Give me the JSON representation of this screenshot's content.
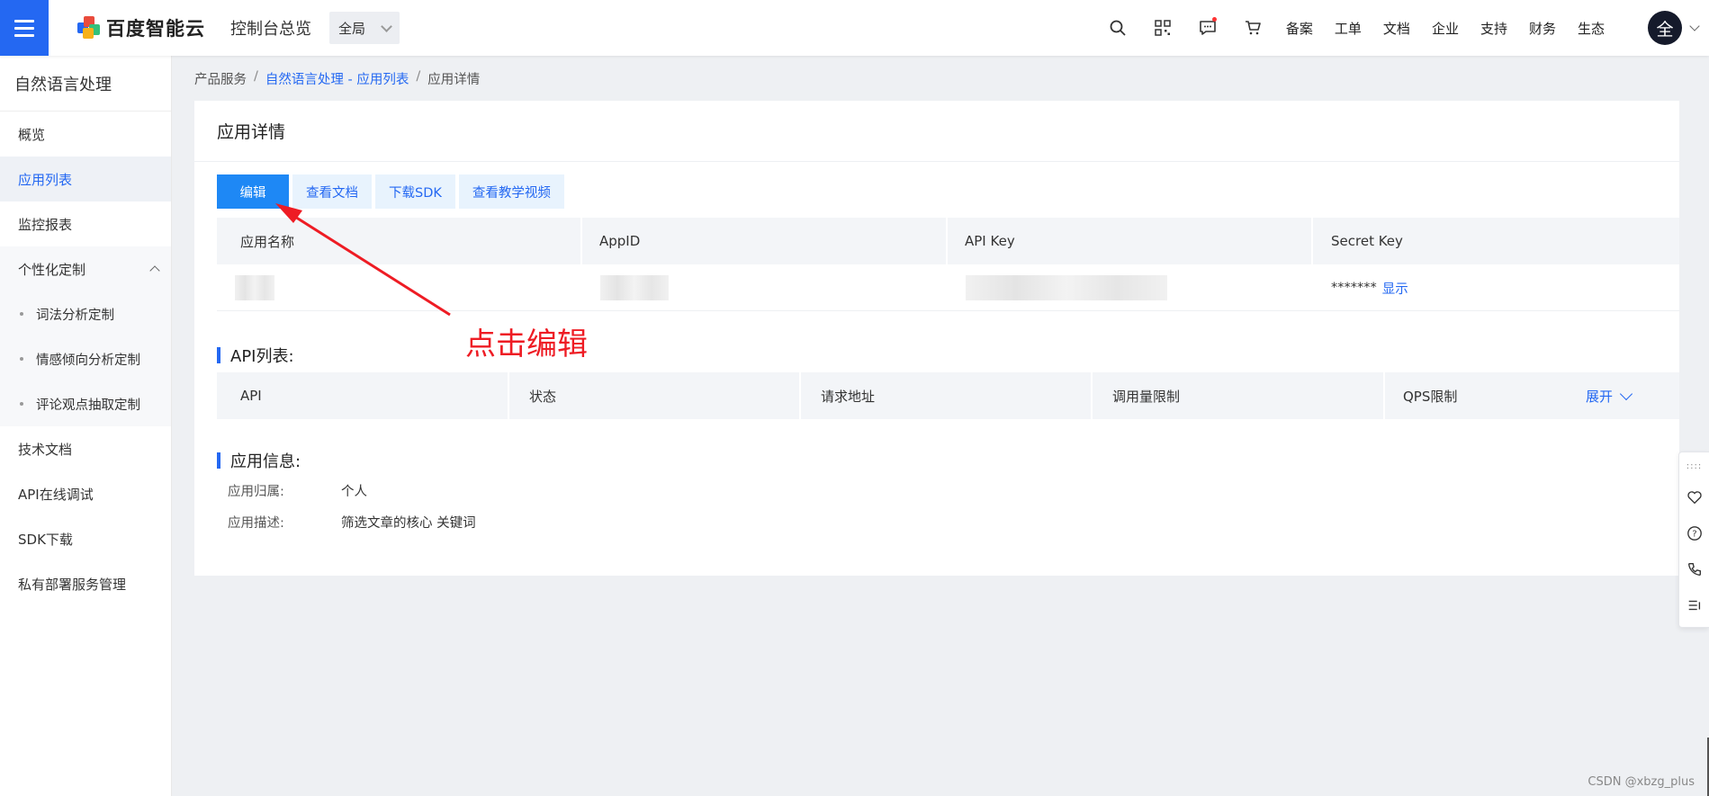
{
  "topbar": {
    "brand": "百度智能云",
    "console_title": "控制台总览",
    "region_value": "全局",
    "nav_links": [
      "备案",
      "工单",
      "文档",
      "企业",
      "支持",
      "财务",
      "生态"
    ],
    "avatar_text": "全",
    "icons": [
      "search-icon",
      "qr-code-icon",
      "message-icon",
      "cart-icon"
    ]
  },
  "sidebar": {
    "title": "自然语言处理",
    "items": [
      {
        "label": "概览"
      },
      {
        "label": "应用列表",
        "active": true
      },
      {
        "label": "监控报表"
      },
      {
        "label": "个性化定制"
      },
      {
        "label": "词法分析定制"
      },
      {
        "label": "情感倾向分析定制"
      },
      {
        "label": "评论观点抽取定制"
      },
      {
        "label": "技术文档"
      },
      {
        "label": "API在线调试"
      },
      {
        "label": "SDK下载"
      },
      {
        "label": "私有部署服务管理"
      }
    ]
  },
  "breadcrumb": {
    "root": "产品服务",
    "link": "自然语言处理 - 应用列表",
    "current": "应用详情",
    "sep": "/"
  },
  "detail": {
    "title": "应用详情",
    "buttons": {
      "edit": "编辑",
      "docs": "查看文档",
      "sdk": "下载SDK",
      "video": "查看教学视频"
    },
    "app_table": {
      "headers": [
        "应用名称",
        "AppID",
        "API Key",
        "Secret Key"
      ],
      "secret_masked": "*******",
      "show_label": "显示"
    },
    "api_section": {
      "title": "API列表:",
      "headers": [
        "API",
        "状态",
        "请求地址",
        "调用量限制",
        "QPS限制"
      ],
      "expand_label": "展开"
    },
    "info_section": {
      "title": "应用信息:",
      "owner_label": "应用归属:",
      "owner_value": "个人",
      "desc_label": "应用描述:",
      "desc_value": "筛选文章的核心 关键词"
    }
  },
  "annotation": {
    "text": "点击编辑",
    "color": "#ee1c24"
  },
  "watermark": "CSDN @xbzg_plus",
  "colors": {
    "accent": "#2468f2",
    "primary_button": "#1e88f5"
  }
}
